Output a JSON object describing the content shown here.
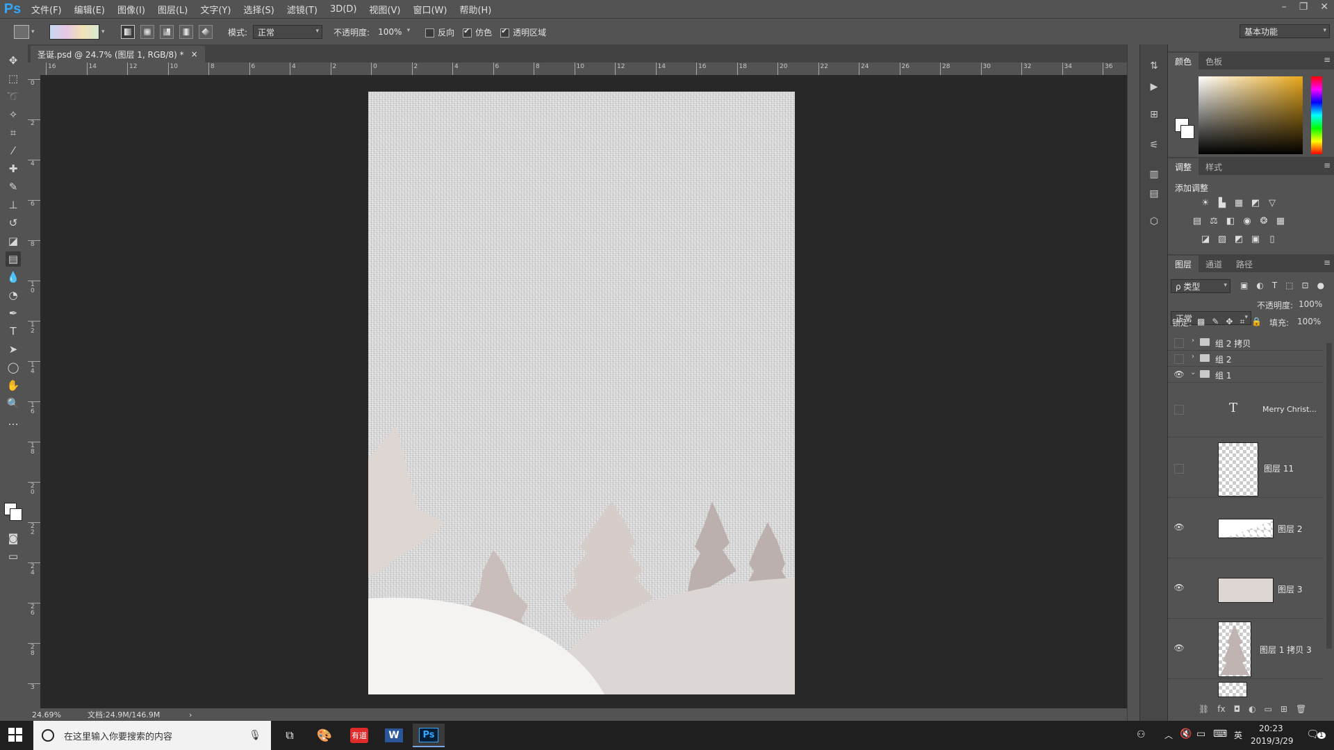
{
  "app": {
    "logo": "Ps"
  },
  "menu": [
    "文件(F)",
    "编辑(E)",
    "图像(I)",
    "图层(L)",
    "文字(Y)",
    "选择(S)",
    "滤镜(T)",
    "3D(D)",
    "视图(V)",
    "窗口(W)",
    "帮助(H)"
  ],
  "options": {
    "mode_label": "模式:",
    "mode_value": "正常",
    "opacity_label": "不透明度:",
    "opacity_value": "100%",
    "reverse_label": "反向",
    "dither_label": "仿色",
    "transparency_label": "透明区域",
    "reverse_checked": false,
    "dither_checked": true,
    "transparency_checked": true,
    "workspace": "基本功能"
  },
  "document": {
    "tab_title": "圣诞.psd @ 24.7% (图层 1, RGB/8) *",
    "close": "×",
    "ruler_top": [
      "16",
      "14",
      "12",
      "10",
      "8",
      "6",
      "4",
      "2",
      "0",
      "2",
      "4",
      "6",
      "8",
      "10",
      "12",
      "14",
      "16",
      "18",
      "20",
      "22",
      "24",
      "26",
      "28",
      "30",
      "32",
      "34",
      "36"
    ],
    "ruler_left": [
      "0",
      "2",
      "4",
      "6",
      "8",
      "10",
      "12",
      "14",
      "16",
      "18",
      "20",
      "22",
      "24",
      "26",
      "28",
      "3"
    ],
    "zoom": "24.69%",
    "doc_info": "文档:24.9M/146.9M",
    "status_caret": "›"
  },
  "color_panel": {
    "tabs": [
      "颜色",
      "色板"
    ]
  },
  "adjust_panel": {
    "tabs": [
      "调整",
      "样式"
    ],
    "title": "添加调整"
  },
  "layers_panel": {
    "tabs": [
      "图层",
      "通道",
      "路径"
    ],
    "filter_label": "ρ 类型",
    "blend_mode": "正常",
    "opacity_label": "不透明度:",
    "opacity_value": "100%",
    "lock_label": "锁定:",
    "fill_label": "填充:",
    "fill_value": "100%",
    "layers": [
      {
        "name": "组 2 拷贝",
        "type": "group",
        "visible": false
      },
      {
        "name": "组 2",
        "type": "group",
        "visible": false
      },
      {
        "name": "组 1",
        "type": "group",
        "visible": true
      },
      {
        "name": "Merry Christ...",
        "type": "text",
        "visible": false
      },
      {
        "name": "图层 11",
        "type": "pixel",
        "visible": false
      },
      {
        "name": "图层 2",
        "type": "pixel",
        "visible": true
      },
      {
        "name": "图层 3",
        "type": "pixel",
        "visible": true
      },
      {
        "name": "图层 1 拷贝 3",
        "type": "pixel",
        "visible": true
      }
    ]
  },
  "taskbar": {
    "search_placeholder": "在这里输入你要搜索的内容",
    "youdao": "有道",
    "ime": "英",
    "time": "20:23",
    "date": "2019/3/29",
    "notification_count": "1"
  }
}
